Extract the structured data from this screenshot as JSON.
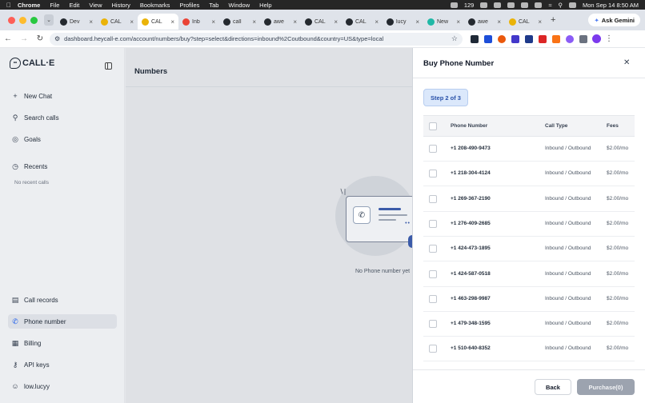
{
  "menubar": {
    "app": "Chrome",
    "items": [
      "File",
      "Edit",
      "View",
      "History",
      "Bookmarks",
      "Profiles",
      "Tab",
      "Window",
      "Help"
    ],
    "battery_count": "129",
    "datetime": "Mon Sep 14  8:50 AM"
  },
  "tabs": [
    {
      "label": "Dev",
      "fav": "github",
      "color": "#24292f"
    },
    {
      "label": "CAL",
      "fav": "calle",
      "color": "#eab308"
    },
    {
      "label": "CAL",
      "fav": "calle",
      "color": "#eab308",
      "active": true
    },
    {
      "label": "Inb",
      "fav": "gmail",
      "color": "#ea4335"
    },
    {
      "label": "call",
      "fav": "github",
      "color": "#24292f"
    },
    {
      "label": "awe",
      "fav": "github",
      "color": "#24292f"
    },
    {
      "label": "CAL",
      "fav": "github",
      "color": "#24292f"
    },
    {
      "label": "CAL",
      "fav": "github",
      "color": "#24292f"
    },
    {
      "label": "lucy",
      "fav": "github",
      "color": "#24292f"
    },
    {
      "label": "New",
      "fav": "perplexity",
      "color": "#20b8a6"
    },
    {
      "label": "awe",
      "fav": "github",
      "color": "#24292f"
    },
    {
      "label": "CAL",
      "fav": "calle",
      "color": "#eab308"
    }
  ],
  "browser": {
    "ask_gemini": "Ask Gemini",
    "url": "dashboard.heycall-e.com/account/numbers/buy?step=select&directions=inbound%2Coutbound&country=US&type=local"
  },
  "sidebar": {
    "logo": "CALL·E",
    "items": [
      {
        "label": "New Chat",
        "icon": "plus-icon"
      },
      {
        "label": "Search calls",
        "icon": "search-icon"
      },
      {
        "label": "Goals",
        "icon": "goals-icon"
      },
      {
        "label": "Recents",
        "icon": "clock-icon"
      }
    ],
    "no_recent": "No recent calls",
    "bottom": [
      {
        "label": "Call records",
        "icon": "clipboard-icon"
      },
      {
        "label": "Phone number",
        "icon": "phone-icon",
        "active": true
      },
      {
        "label": "Billing",
        "icon": "billing-icon"
      },
      {
        "label": "API keys",
        "icon": "key-icon"
      },
      {
        "label": "low.lucyy",
        "icon": "user-icon"
      }
    ]
  },
  "main": {
    "title": "Numbers",
    "empty_message": "No Phone number yet"
  },
  "drawer": {
    "title": "Buy Phone Number",
    "step": "Step 2 of 3",
    "columns": [
      "Phone Number",
      "Call Type",
      "Fees"
    ],
    "rows": [
      {
        "number": "+1 208-490-9473",
        "type": "Inbound / Outbound",
        "fee": "$2.00/mo"
      },
      {
        "number": "+1 218-304-4124",
        "type": "Inbound / Outbound",
        "fee": "$2.00/mo"
      },
      {
        "number": "+1 269-367-2190",
        "type": "Inbound / Outbound",
        "fee": "$2.00/mo"
      },
      {
        "number": "+1 276-409-2685",
        "type": "Inbound / Outbound",
        "fee": "$2.00/mo"
      },
      {
        "number": "+1 424-473-1895",
        "type": "Inbound / Outbound",
        "fee": "$2.00/mo"
      },
      {
        "number": "+1 424-587-0518",
        "type": "Inbound / Outbound",
        "fee": "$2.00/mo"
      },
      {
        "number": "+1 463-298-9987",
        "type": "Inbound / Outbound",
        "fee": "$2.00/mo"
      },
      {
        "number": "+1 479-348-1595",
        "type": "Inbound / Outbound",
        "fee": "$2.00/mo"
      },
      {
        "number": "+1 510-640-8352",
        "type": "Inbound / Outbound",
        "fee": "$2.00/mo"
      }
    ],
    "back_label": "Back",
    "purchase_label": "Purchase(0)"
  }
}
